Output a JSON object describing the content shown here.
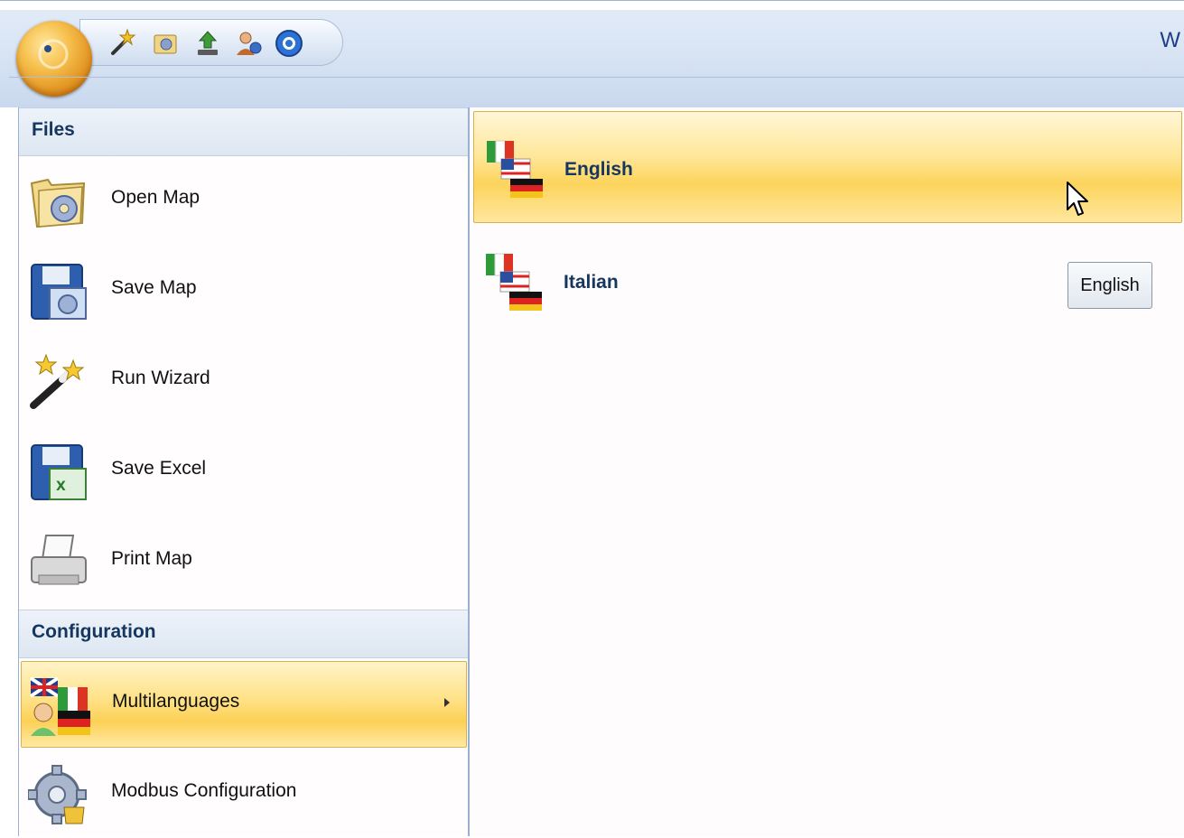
{
  "ribbon": {
    "title_fragment": "W",
    "quick_access": [
      "wizard-icon",
      "open-map-icon",
      "save-icon",
      "users-icon",
      "help-icon"
    ]
  },
  "sidebar": {
    "sections": [
      {
        "header": "Files",
        "items": [
          {
            "label": "Open Map",
            "icon": "open-map-icon"
          },
          {
            "label": "Save Map",
            "icon": "save-map-icon"
          },
          {
            "label": "Run Wizard",
            "icon": "run-wizard-icon"
          },
          {
            "label": "Save Excel",
            "icon": "save-excel-icon"
          },
          {
            "label": "Print Map",
            "icon": "print-map-icon"
          }
        ]
      },
      {
        "header": "Configuration",
        "items": [
          {
            "label": "Multilanguages",
            "icon": "multilanguages-icon",
            "selected": true,
            "has_submenu": true
          },
          {
            "label": "Modbus Configuration",
            "icon": "modbus-configuration-icon"
          }
        ]
      }
    ]
  },
  "submenu": {
    "items": [
      {
        "label": "English",
        "icon": "language-flags-icon",
        "hovered": true
      },
      {
        "label": "Italian",
        "icon": "language-flags-icon"
      }
    ],
    "tooltip_button": "English"
  },
  "colors": {
    "highlight": "#fcd056",
    "header_text": "#15365f",
    "ribbon_bg": "#d7e3f4"
  }
}
